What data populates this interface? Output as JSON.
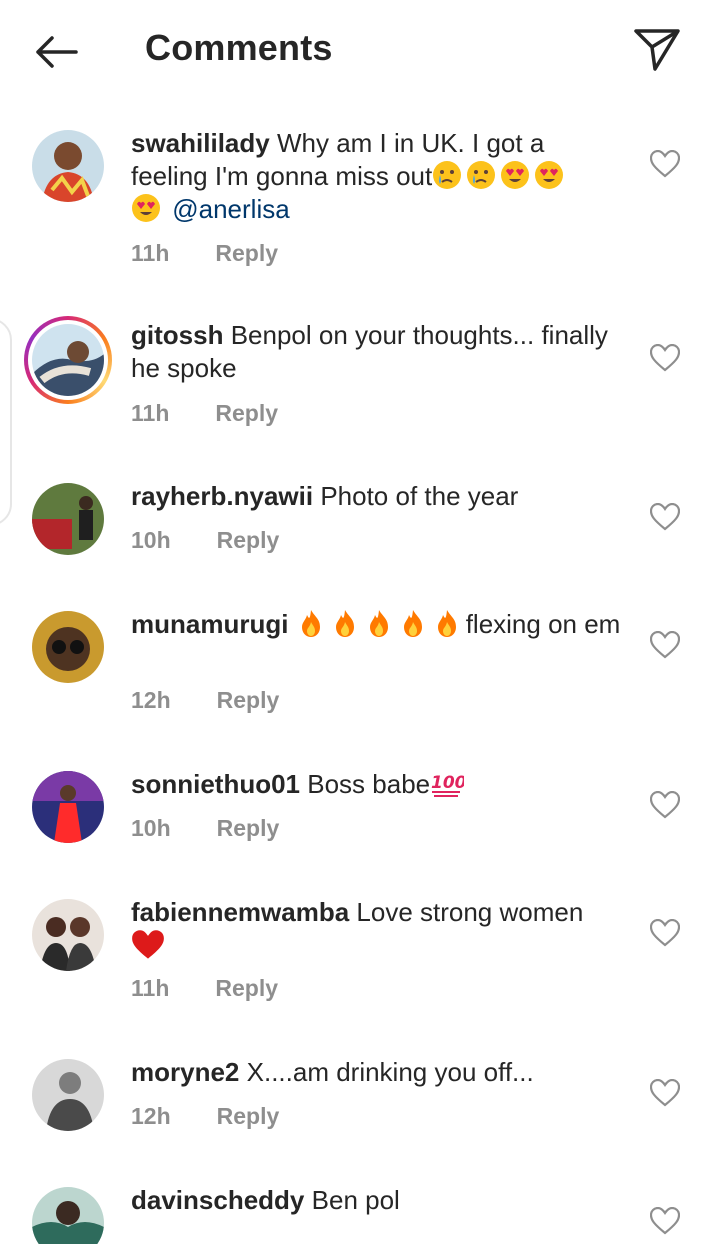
{
  "header": {
    "title": "Comments"
  },
  "icons": {
    "back": "arrow-left-icon",
    "share": "paper-plane-icon",
    "like": "heart-outline-icon"
  },
  "comments": [
    {
      "username": "swahililady",
      "text": "Why am I in UK. I got a feeling I'm gonna miss out",
      "emojis_after": [
        "crying-face",
        "crying-face",
        "heart-eyes",
        "heart-eyes",
        "heart-eyes"
      ],
      "mention": "@anerlisa",
      "time": "11h",
      "reply": "Reply"
    },
    {
      "username": "gitossh",
      "text": "Benpol  on your thoughts... finally he spoke",
      "time": "11h",
      "reply": "Reply",
      "has_story": true
    },
    {
      "username": "rayherb.nyawii",
      "text": "Photo of the year",
      "time": "10h",
      "reply": "Reply"
    },
    {
      "username": "munamurugi",
      "text": "flexing on em",
      "emojis_before": [
        "fire",
        "fire",
        "fire",
        "fire",
        "fire"
      ],
      "time": "12h",
      "reply": "Reply"
    },
    {
      "username": "sonniethuo01",
      "text": "Boss babe",
      "emojis_after": [
        "hundred-points"
      ],
      "time": "10h",
      "reply": "Reply"
    },
    {
      "username": "fabiennemwamba",
      "text": "Love strong women",
      "emojis_after": [
        "red-heart"
      ],
      "time": "11h",
      "reply": "Reply"
    },
    {
      "username": "moryne2",
      "text": "X....am drinking you off...",
      "time": "12h",
      "reply": "Reply"
    },
    {
      "username": "davinscheddy",
      "text": "Ben pol",
      "time": "",
      "reply": ""
    }
  ],
  "colors": {
    "text": "#262626",
    "meta": "#8e8e8e",
    "mention": "#00376b",
    "heart": "#e0245e"
  }
}
